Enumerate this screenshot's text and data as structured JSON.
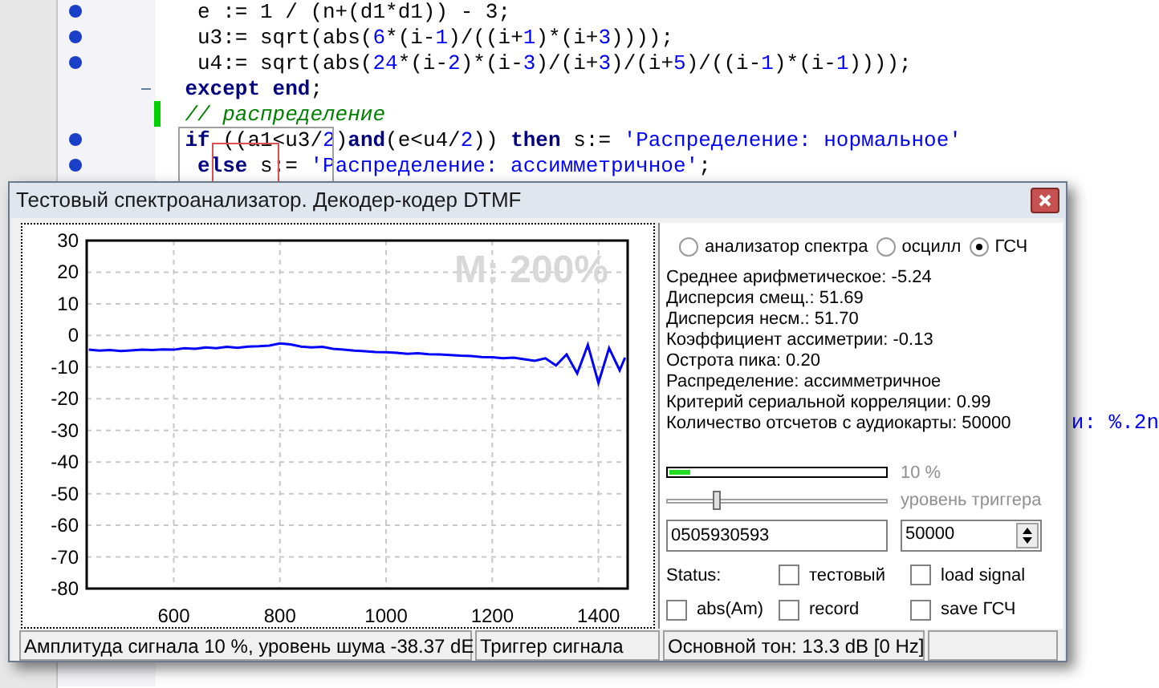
{
  "editor": {
    "lines": [
      {
        "breakpoint": true,
        "fold": false,
        "modified": false,
        "tokens": [
          {
            "kind": "plain",
            "text": "  e := 1 / (n+(d1*d1)) - 3;"
          }
        ]
      },
      {
        "breakpoint": true,
        "fold": false,
        "modified": false,
        "tokens": [
          {
            "kind": "plain",
            "text": "  u3:= sqrt(abs("
          },
          {
            "kind": "num",
            "text": "6"
          },
          {
            "kind": "plain",
            "text": "*(i-"
          },
          {
            "kind": "num",
            "text": "1"
          },
          {
            "kind": "plain",
            "text": ")/((i+"
          },
          {
            "kind": "num",
            "text": "1"
          },
          {
            "kind": "plain",
            "text": ")*(i+"
          },
          {
            "kind": "num",
            "text": "3"
          },
          {
            "kind": "plain",
            "text": "))));"
          }
        ]
      },
      {
        "breakpoint": true,
        "fold": false,
        "modified": false,
        "tokens": [
          {
            "kind": "plain",
            "text": "  u4:= sqrt(abs("
          },
          {
            "kind": "num",
            "text": "24"
          },
          {
            "kind": "plain",
            "text": "*(i-"
          },
          {
            "kind": "num",
            "text": "2"
          },
          {
            "kind": "plain",
            "text": ")*(i-"
          },
          {
            "kind": "num",
            "text": "3"
          },
          {
            "kind": "plain",
            "text": ")/(i+"
          },
          {
            "kind": "num",
            "text": "3"
          },
          {
            "kind": "plain",
            "text": ")/(i+"
          },
          {
            "kind": "num",
            "text": "5"
          },
          {
            "kind": "plain",
            "text": ")/((i-"
          },
          {
            "kind": "num",
            "text": "1"
          },
          {
            "kind": "plain",
            "text": ")*(i-"
          },
          {
            "kind": "num",
            "text": "1"
          },
          {
            "kind": "plain",
            "text": "))));"
          }
        ]
      },
      {
        "breakpoint": false,
        "fold": true,
        "modified": false,
        "tokens": [
          {
            "kind": "kw",
            "text": " except end"
          },
          {
            "kind": "plain",
            "text": ";"
          }
        ]
      },
      {
        "breakpoint": false,
        "fold": false,
        "modified": true,
        "tokens": [
          {
            "kind": "comment",
            "text": " // распределение"
          }
        ]
      },
      {
        "breakpoint": true,
        "fold": false,
        "modified": false,
        "tokens": [
          {
            "kind": "kw",
            "text": " if"
          },
          {
            "kind": "plain",
            "text": " ((a1<u3/"
          },
          {
            "kind": "num",
            "text": "2"
          },
          {
            "kind": "plain",
            "text": ")"
          },
          {
            "kind": "kw",
            "text": "and"
          },
          {
            "kind": "plain",
            "text": "(e<u4/"
          },
          {
            "kind": "num",
            "text": "2"
          },
          {
            "kind": "plain",
            "text": ")) "
          },
          {
            "kind": "kw",
            "text": "then"
          },
          {
            "kind": "plain",
            "text": " s:= "
          },
          {
            "kind": "str",
            "text": "'Распределение: нормальное'"
          }
        ]
      },
      {
        "breakpoint": true,
        "fold": false,
        "modified": false,
        "tokens": [
          {
            "kind": "kw",
            "text": "  else"
          },
          {
            "kind": "plain",
            "text": " s:= "
          },
          {
            "kind": "str",
            "text": "'Распределение: ассимметричное'"
          },
          {
            "kind": "plain",
            "text": ";"
          }
        ]
      }
    ],
    "fragment": "и: %.2n"
  },
  "window": {
    "title": "Тестовый спектроанализатор. Декодер-кодер DTMF",
    "chart_data": {
      "type": "line",
      "xlim": [
        436,
        1455
      ],
      "ylim": [
        -80,
        30
      ],
      "xticks": [
        600,
        800,
        1000,
        1200,
        1400
      ],
      "yticks": [
        30,
        20,
        10,
        0,
        -10,
        -20,
        -30,
        -40,
        -50,
        -60,
        -70,
        -80
      ],
      "x": [
        440,
        460,
        480,
        500,
        520,
        540,
        560,
        580,
        600,
        620,
        640,
        660,
        680,
        700,
        720,
        740,
        760,
        780,
        800,
        820,
        840,
        860,
        880,
        900,
        920,
        940,
        960,
        980,
        1000,
        1020,
        1040,
        1060,
        1080,
        1100,
        1120,
        1140,
        1160,
        1180,
        1200,
        1220,
        1240,
        1260,
        1280,
        1300,
        1320,
        1340,
        1360,
        1380,
        1400,
        1420,
        1440,
        1450
      ],
      "grid": true,
      "series": [
        {
          "color": "#0000ff",
          "values": [
            -4.5,
            -4.8,
            -4.6,
            -4.9,
            -4.7,
            -4.5,
            -4.6,
            -4.4,
            -4.5,
            -4.0,
            -4.2,
            -3.8,
            -4.0,
            -3.6,
            -3.9,
            -3.5,
            -3.4,
            -3.2,
            -2.5,
            -2.8,
            -3.5,
            -3.8,
            -3.6,
            -4.2,
            -4.5,
            -4.8,
            -5.0,
            -5.2,
            -5.3,
            -5.5,
            -5.8,
            -5.6,
            -5.9,
            -6.0,
            -6.2,
            -6.4,
            -6.5,
            -6.8,
            -6.9,
            -7.2,
            -7.0,
            -7.5,
            -8.0,
            -7.2,
            -9.5,
            -6,
            -12,
            -3,
            -15,
            -4,
            -11,
            -7
          ]
        }
      ],
      "annotations": [
        "M: 200%"
      ]
    },
    "modes": [
      {
        "label": "анализатор спектра",
        "selected": false
      },
      {
        "label": "осцилл",
        "selected": false
      },
      {
        "label": "ГСЧ",
        "selected": true
      }
    ],
    "stats": [
      "Среднее арифметическое: -5.24",
      "Дисперсия смещ.: 51.69",
      "Дисперсия несм.: 51.70",
      "Коэффициент ассиметрии: -0.13",
      "Острота пика: 0.20",
      "Распределение: ассимметричное",
      "Критерий сериальной корреляции: 0.99",
      "Количество отсчетов с аудиокарты: 50000"
    ],
    "amplitude": {
      "level": 0.1,
      "reading": "10 %"
    },
    "trigger": {
      "level": 0.22,
      "label": "уровень триггера"
    },
    "number_field": {
      "value": "0505930593"
    },
    "count_field": {
      "value": "50000"
    },
    "status_label": "Status:",
    "checkboxes": [
      {
        "label": "тестовый",
        "checked": false
      },
      {
        "label": "load signal",
        "checked": false
      },
      {
        "label": "abs(Am)",
        "checked": false
      },
      {
        "label": "record",
        "checked": false
      },
      {
        "label": "save ГСЧ",
        "checked": false
      }
    ],
    "status_bar": [
      "Амплитуда сигнала 10 %, уровень шума -38.37 dE",
      "Триггер сигнала",
      "Основной тон: 13.3 dB [0 Hz]"
    ]
  }
}
